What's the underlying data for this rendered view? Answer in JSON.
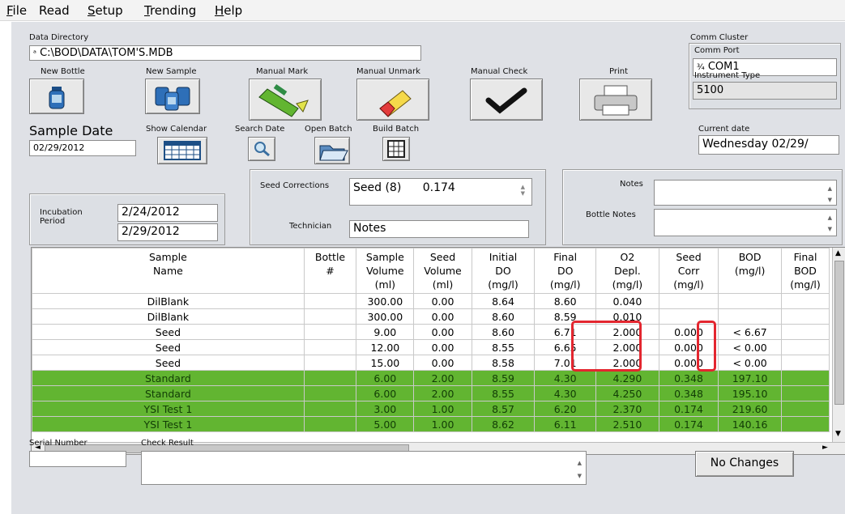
{
  "menu": [
    "File",
    "Read",
    "Setup",
    "Trending",
    "Help"
  ],
  "data_directory": {
    "label": "Data Directory",
    "value": "C:\\BOD\\DATA\\TOM'S.MDB"
  },
  "comm": {
    "cluster_label": "Comm Cluster",
    "port_label": "Comm Port",
    "port_value": "COM1",
    "instrument_label": "Instrument Type",
    "instrument_value": "5100"
  },
  "toolbar": {
    "new_bottle": "New Bottle",
    "new_sample": "New Sample",
    "manual_mark": "Manual Mark",
    "manual_unmark": "Manual Unmark",
    "manual_check": "Manual Check",
    "print": "Print"
  },
  "sample_date": {
    "label": "Sample Date",
    "value": "02/29/2012",
    "show_calendar": "Show Calendar",
    "search_date": "Search Date",
    "open_batch": "Open Batch",
    "build_batch": "Build Batch"
  },
  "current_date": {
    "label": "Current date",
    "value": "Wednesday 02/29/"
  },
  "incubation": {
    "label": "Incubation Period",
    "start": "2/24/2012",
    "end": "2/29/2012"
  },
  "seed": {
    "label": "Seed Corrections",
    "value_name": "Seed (8)",
    "value_num": "0.174",
    "technician_label": "Technician",
    "technician_value": "Notes"
  },
  "notes": {
    "notes_label": "Notes",
    "bottle_notes_label": "Bottle Notes"
  },
  "table": {
    "headers": [
      "Sample Name",
      "Bottle #",
      "Sample Volume (ml)",
      "Seed Volume (ml)",
      "Initial DO (mg/l)",
      "Final DO (mg/l)",
      "O2 Depl. (mg/l)",
      "Seed Corr (mg/l)",
      "BOD (mg/l)",
      "Final BOD (mg/l)"
    ],
    "rows": [
      {
        "cells": [
          "DilBlank",
          "",
          "300.00",
          "0.00",
          "8.64",
          "8.60",
          "0.040",
          "",
          "",
          ""
        ],
        "green": false
      },
      {
        "cells": [
          "DilBlank",
          "",
          "300.00",
          "0.00",
          "8.60",
          "8.59",
          "0.010",
          "",
          "",
          ""
        ],
        "green": false
      },
      {
        "cells": [
          "Seed",
          "",
          "9.00",
          "0.00",
          "8.60",
          "6.71",
          "2.000",
          "0.000",
          "< 6.67",
          ""
        ],
        "green": false
      },
      {
        "cells": [
          "Seed",
          "",
          "12.00",
          "0.00",
          "8.55",
          "6.65",
          "2.000",
          "0.000",
          "< 0.00",
          ""
        ],
        "green": false
      },
      {
        "cells": [
          "Seed",
          "",
          "15.00",
          "0.00",
          "8.58",
          "7.01",
          "2.000",
          "0.000",
          "< 0.00",
          ""
        ],
        "green": false
      },
      {
        "cells": [
          "Standard",
          "",
          "6.00",
          "2.00",
          "8.59",
          "4.30",
          "4.290",
          "0.348",
          "197.10",
          ""
        ],
        "green": true
      },
      {
        "cells": [
          "Standard",
          "",
          "6.00",
          "2.00",
          "8.55",
          "4.30",
          "4.250",
          "0.348",
          "195.10",
          ""
        ],
        "green": true
      },
      {
        "cells": [
          "YSI Test 1",
          "",
          "3.00",
          "1.00",
          "8.57",
          "6.20",
          "2.370",
          "0.174",
          "219.60",
          ""
        ],
        "green": true
      },
      {
        "cells": [
          "YSI Test 1",
          "",
          "5.00",
          "1.00",
          "8.62",
          "6.11",
          "2.510",
          "0.174",
          "140.16",
          ""
        ],
        "green": true
      }
    ]
  },
  "bottom": {
    "serial_label": "Serial Number",
    "check_label": "Check Result",
    "no_changes": "No Changes"
  },
  "icons": {
    "up": "▲",
    "down": "▼",
    "left": "◄",
    "right": "►"
  }
}
